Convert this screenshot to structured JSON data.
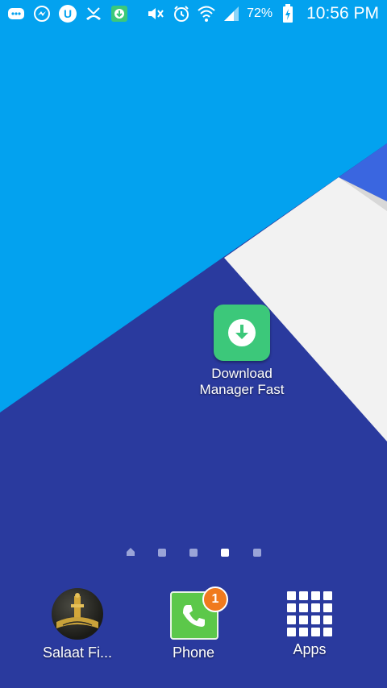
{
  "status_bar": {
    "icons_left": [
      "messages-icon",
      "messenger-icon",
      "u-icon",
      "missed-call-icon",
      "download-notification-icon"
    ],
    "icons_right": [
      "mute-icon",
      "alarm-icon",
      "wifi-icon",
      "signal-icon",
      "battery-charging-icon"
    ],
    "battery_percent": "72%",
    "time": "10:56 PM"
  },
  "home_screen": {
    "shortcut": {
      "label": "Download\nManager Fast",
      "icon": "download-icon",
      "color": "#3cc87a"
    },
    "pages": {
      "count": 5,
      "current": 4
    }
  },
  "dock": {
    "items": [
      {
        "label": "Salaat Fi...",
        "icon": "salaat-app-icon"
      },
      {
        "label": "Phone",
        "icon": "phone-icon",
        "badge": "1"
      },
      {
        "label": "Apps",
        "icon": "apps-grid-icon"
      }
    ]
  },
  "colors": {
    "sky": "#03a2ef",
    "deep_blue": "#2a3a9e",
    "white_panel": "#f2f2f2",
    "accent_green": "#3cc87a",
    "badge_orange": "#f07a1e"
  }
}
